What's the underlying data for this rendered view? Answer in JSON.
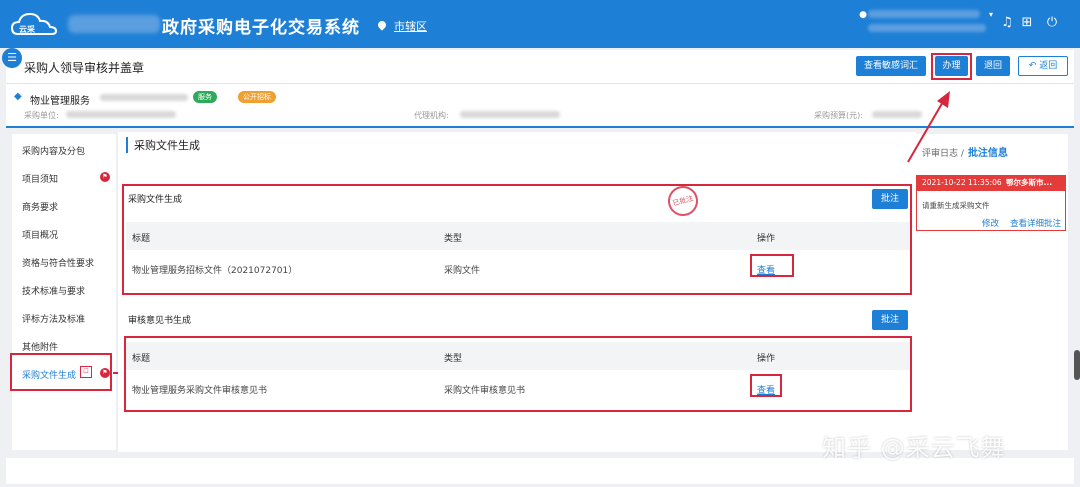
{
  "header": {
    "system_title": "政府采购电子化交易系统",
    "region": "市辖区"
  },
  "toolbar": {
    "page_title": "采购人领导审核并盖章",
    "btn_sensitive": "查看敏感词汇",
    "btn_handle": "办理",
    "btn_back": "退回",
    "btn_return": "返回"
  },
  "project": {
    "name": "物业管理服务",
    "tag_service": "服务",
    "tag_public": "公开招标",
    "purchaser_label": "采购单位:",
    "agency_label": "代理机构:",
    "budget_label": "采购预算(元):"
  },
  "sidebar": {
    "items": [
      {
        "label": "采购内容及分包"
      },
      {
        "label": "项目须知"
      },
      {
        "label": "商务要求"
      },
      {
        "label": "项目概况"
      },
      {
        "label": "资格与符合性要求"
      },
      {
        "label": "技术标准与要求"
      },
      {
        "label": "评标方法及标准"
      },
      {
        "label": "其他附件"
      },
      {
        "label": "采购文件生成"
      }
    ]
  },
  "main": {
    "title": "采购文件生成",
    "section1": {
      "title": "采购文件生成",
      "annotate_btn": "批注",
      "stamp": "已批注",
      "headers": [
        "标题",
        "类型",
        "操作"
      ],
      "row": {
        "title": "物业管理服务招标文件（2021072701）",
        "type": "采购文件",
        "action": "查看"
      }
    },
    "section2": {
      "title": "审核意见书生成",
      "annotate_btn": "批注",
      "headers": [
        "标题",
        "类型",
        "操作"
      ],
      "row": {
        "title": "物业管理服务采购文件审核意见书",
        "type": "采购文件审核意见书",
        "action": "查看"
      }
    }
  },
  "right_panel": {
    "tab_log": "评审日志",
    "separator": "/",
    "tab_annotation": "批注信息",
    "card": {
      "time": "2021-10-22 11:35:06",
      "place": "鄂尔多斯市...",
      "content": "请重新生成采购文件",
      "edit": "修改",
      "detail": "查看详细批注"
    }
  },
  "watermark": "知乎 @采云飞舞",
  "colors": {
    "primary": "#1e7fd6",
    "highlight": "#d7263d",
    "tag_green": "#2eaa5a",
    "tag_orange": "#f0a030"
  }
}
